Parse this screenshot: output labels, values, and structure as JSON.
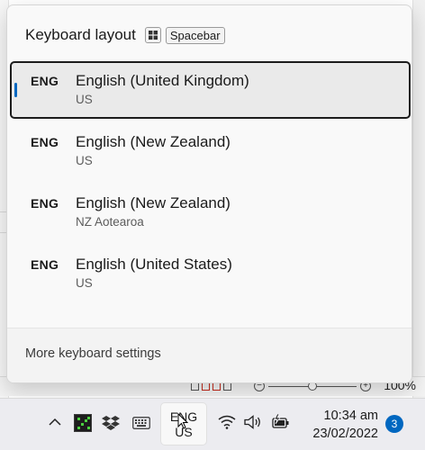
{
  "flyout": {
    "title": "Keyboard layout",
    "shortcut_key": "Spacebar",
    "layouts": [
      {
        "code": "ENG",
        "name": "English (United Kingdom)",
        "keyboard": "US",
        "selected": true
      },
      {
        "code": "ENG",
        "name": "English (New Zealand)",
        "keyboard": "US",
        "selected": false
      },
      {
        "code": "ENG",
        "name": "English (New Zealand)",
        "keyboard": "NZ Aotearoa",
        "selected": false
      },
      {
        "code": "ENG",
        "name": "English (United States)",
        "keyboard": "US",
        "selected": false
      }
    ],
    "footer_link": "More keyboard settings"
  },
  "status_bar": {
    "zoom": "100%"
  },
  "taskbar": {
    "input_indicator": {
      "line1": "ENG",
      "line2": "US"
    },
    "time": "10:34 am",
    "date": "23/02/2022",
    "notification_count": "3"
  },
  "colors": {
    "accent": "#0067c0",
    "selected_border": "#1c1c1c"
  }
}
